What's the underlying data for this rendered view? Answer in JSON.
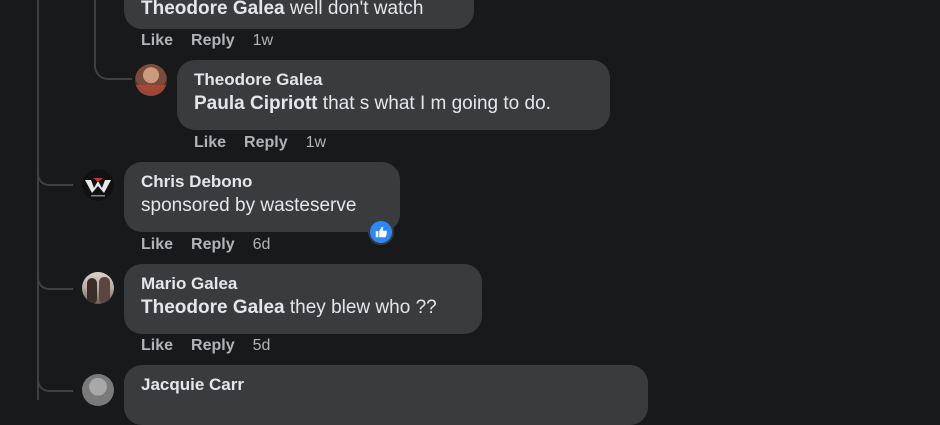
{
  "comments": [
    {
      "author": "",
      "mention": "Theodore Galea",
      "text": " well don't watch",
      "actions": {
        "like": "Like",
        "reply": "Reply",
        "time": "1w"
      }
    },
    {
      "author": "Theodore Galea",
      "mention": "Paula Cipriott",
      "text": " that s what I m going to do.",
      "actions": {
        "like": "Like",
        "reply": "Reply",
        "time": "1w"
      }
    },
    {
      "author": "Chris Debono",
      "mention": "",
      "text": "sponsored by wasteserve",
      "reaction_icon": "like-thumb-icon",
      "actions": {
        "like": "Like",
        "reply": "Reply",
        "time": "6d"
      }
    },
    {
      "author": "Mario Galea",
      "mention": "Theodore Galea",
      "text": " they blew who ??",
      "actions": {
        "like": "Like",
        "reply": "Reply",
        "time": "5d"
      }
    },
    {
      "author": "Jacquie Carr",
      "mention": "",
      "text": ""
    }
  ],
  "colors": {
    "background": "#18191a",
    "bubble": "#3a3b3c",
    "text": "#e4e6eb",
    "secondary": "#b0b3b8",
    "reaction": "#2d88ff"
  }
}
